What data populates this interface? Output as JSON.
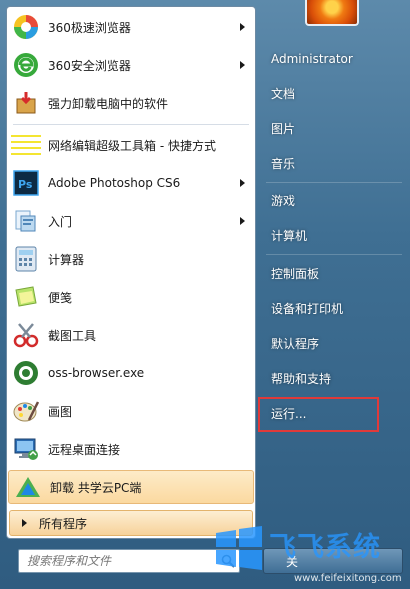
{
  "programs": [
    {
      "label": "360极速浏览器",
      "icon": "360-speed-browser-icon",
      "submenu": true
    },
    {
      "label": "360安全浏览器",
      "icon": "360-secure-browser-icon",
      "submenu": true
    },
    {
      "label": "强力卸载电脑中的软件",
      "icon": "uninstaller-icon",
      "submenu": false
    },
    {
      "label": "网络编辑超级工具箱 - 快捷方式",
      "icon": "notepad-icon",
      "submenu": false
    },
    {
      "label": "Adobe Photoshop CS6",
      "icon": "photoshop-icon",
      "submenu": true
    },
    {
      "label": "入门",
      "icon": "getting-started-icon",
      "submenu": true
    },
    {
      "label": "计算器",
      "icon": "calculator-icon",
      "submenu": false
    },
    {
      "label": "便笺",
      "icon": "sticky-notes-icon",
      "submenu": false
    },
    {
      "label": "截图工具",
      "icon": "snipping-tool-icon",
      "submenu": false
    },
    {
      "label": "oss-browser.exe",
      "icon": "oss-browser-icon",
      "submenu": false
    },
    {
      "label": "画图",
      "icon": "paint-icon",
      "submenu": false
    },
    {
      "label": "远程桌面连接",
      "icon": "remote-desktop-icon",
      "submenu": false
    },
    {
      "label": "卸载 共学云PC端",
      "icon": "gongxueyun-icon",
      "submenu": false,
      "highlighted": true
    }
  ],
  "all_programs": "所有程序",
  "search": {
    "placeholder": "搜索程序和文件"
  },
  "right": {
    "user": "Administrator",
    "documents": "文档",
    "pictures": "图片",
    "music": "音乐",
    "games": "游戏",
    "computer": "计算机",
    "control_panel": "控制面板",
    "devices_printers": "设备和打印机",
    "default_programs": "默认程序",
    "help_support": "帮助和支持",
    "run": "运行..."
  },
  "shutdown_label": "关",
  "watermark": {
    "text": "飞飞系统",
    "url": "www.feifeixitong.com"
  },
  "colors": {
    "highlight": "#fbd9a0",
    "run_box": "#e03a3a",
    "watermark": "#2896ff"
  }
}
